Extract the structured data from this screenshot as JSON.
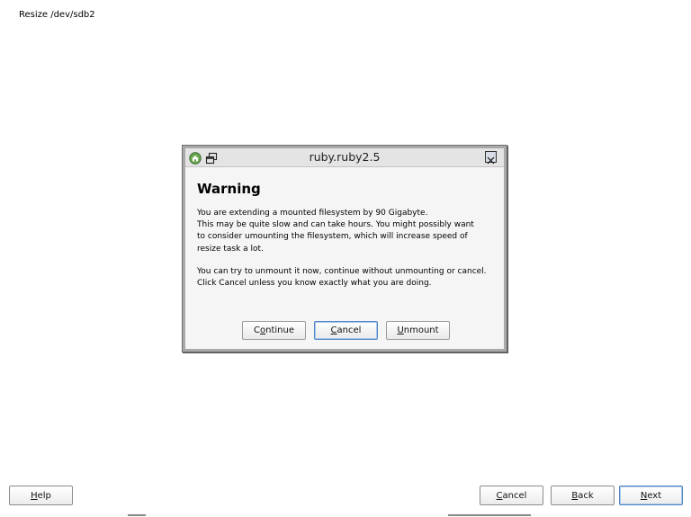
{
  "page": {
    "title": "Resize /dev/sdb2"
  },
  "dialog": {
    "window_title": "ruby.ruby2.5",
    "heading": "Warning",
    "paragraph1": "You are extending a mounted filesystem by 90 Gigabyte.\nThis may be quite slow and can take hours. You might possibly want\nto consider umounting the filesystem, which will increase speed of\nresize task a lot.",
    "paragraph2": "You can try to unmount it now, continue without unmounting or cancel.\nClick Cancel unless you know exactly what you are doing.",
    "buttons": {
      "continue": {
        "prefix": "C",
        "mnemonic": "o",
        "rest": "ntinue"
      },
      "cancel": {
        "prefix": "",
        "mnemonic": "C",
        "rest": "ancel"
      },
      "unmount": {
        "prefix": "",
        "mnemonic": "U",
        "rest": "nmount"
      }
    },
    "focused_button": "cancel"
  },
  "footer": {
    "help": {
      "prefix": "",
      "mnemonic": "H",
      "rest": "elp"
    },
    "cancel": {
      "prefix": "",
      "mnemonic": "C",
      "rest": "ancel"
    },
    "back": {
      "prefix": "",
      "mnemonic": "B",
      "rest": "ack"
    },
    "next": {
      "prefix": "",
      "mnemonic": "N",
      "rest": "ext"
    },
    "default_button": "next"
  },
  "icons": {
    "app": "home-icon",
    "restore": "restore-window-icon",
    "close": "close-icon"
  }
}
